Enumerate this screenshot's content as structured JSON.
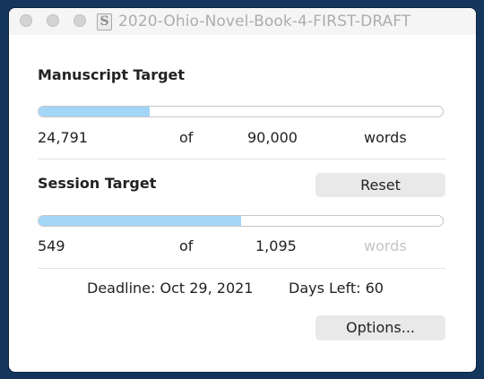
{
  "window": {
    "title": "2020-Ohio-Novel-Book-4-FIRST-DRAFT",
    "doc_icon": "S"
  },
  "manuscript": {
    "heading": "Manuscript Target",
    "current": "24,791",
    "of_label": "of",
    "target": "90,000",
    "unit": "words",
    "progress": 0.275
  },
  "session": {
    "heading": "Session Target",
    "reset_label": "Reset",
    "current": "549",
    "of_label": "of",
    "target": "1,095",
    "unit": "words",
    "progress": 0.501
  },
  "footer": {
    "deadline": "Deadline: Oct 29, 2021",
    "days_left": "Days Left: 60",
    "options_label": "Options..."
  },
  "colors": {
    "progress_fill": "#a3d5f7",
    "desktop": "#14365d"
  }
}
